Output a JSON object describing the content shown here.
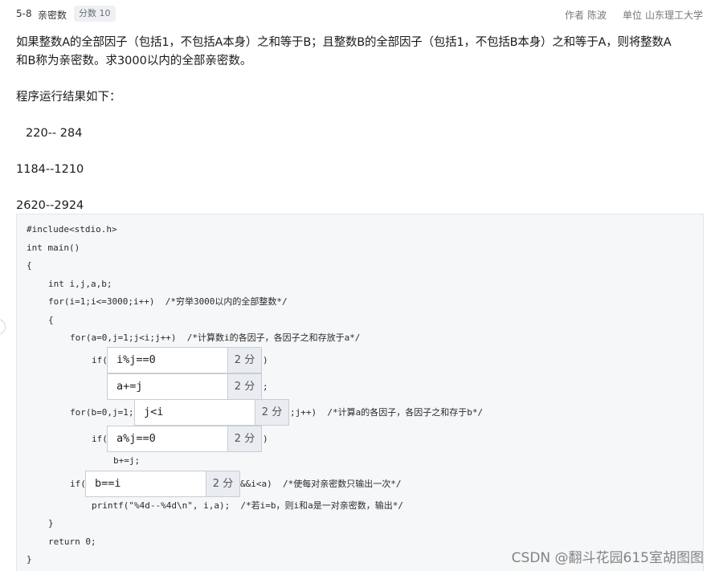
{
  "header": {
    "problem_id": "5-8",
    "title": "亲密数",
    "score": "分数 10",
    "author_label": "作者",
    "author": "陈波",
    "unit_label": "单位",
    "unit": "山东理工大学"
  },
  "description": {
    "line1": "如果整数A的全部因子（包括1，不包括A本身）之和等于B；且整数B的全部因子（包括1，不包括B本身）之和等于A，则将整数A",
    "line2": "和B称为亲密数。求3000以内的全部亲密数。",
    "line3": "程序运行结果如下：",
    "out1": "220-- 284",
    "out2": "1184--1210",
    "out3": "2620--2924"
  },
  "code": {
    "l1": "#include<stdio.h>",
    "l2": "int main()",
    "l3": "{",
    "l4": "int i,j,a,b;",
    "l5": "for(i=1;i<=3000;i++)  /*穷举3000以内的全部整数*/",
    "l6": "{",
    "l7": "for(a=0,j=1;j<i;j++)  /*计算数i的各因子，各因子之和存放于a*/",
    "l8_pre": "if(",
    "l8_post": ")",
    "l9_post": ";",
    "l10_pre": "for(b=0,j=1;",
    "l10_post": ";j++)  /*计算a的各因子，各因子之和存于b*/",
    "l11_pre": "if(",
    "l11_post": ")",
    "l12": "b+=j;",
    "l13_pre": "if(",
    "l13_post": "&&i<a)  /*使每对亲密数只输出一次*/",
    "l14": "printf(\"%4d--%4d\\n\", i,a);  /*若i=b，则i和a是一对亲密数，输出*/",
    "l15": "}",
    "l16": "return 0;",
    "l17": "}"
  },
  "blanks": [
    {
      "answer": "i%j==0",
      "points": "2 分"
    },
    {
      "answer": "a+=j",
      "points": "2 分"
    },
    {
      "answer": "j<i",
      "points": "2 分"
    },
    {
      "answer": "a%j==0",
      "points": "2 分"
    },
    {
      "answer": "b==i",
      "points": "2 分"
    }
  ],
  "watermark": "CSDN @翻斗花园615室胡图图"
}
